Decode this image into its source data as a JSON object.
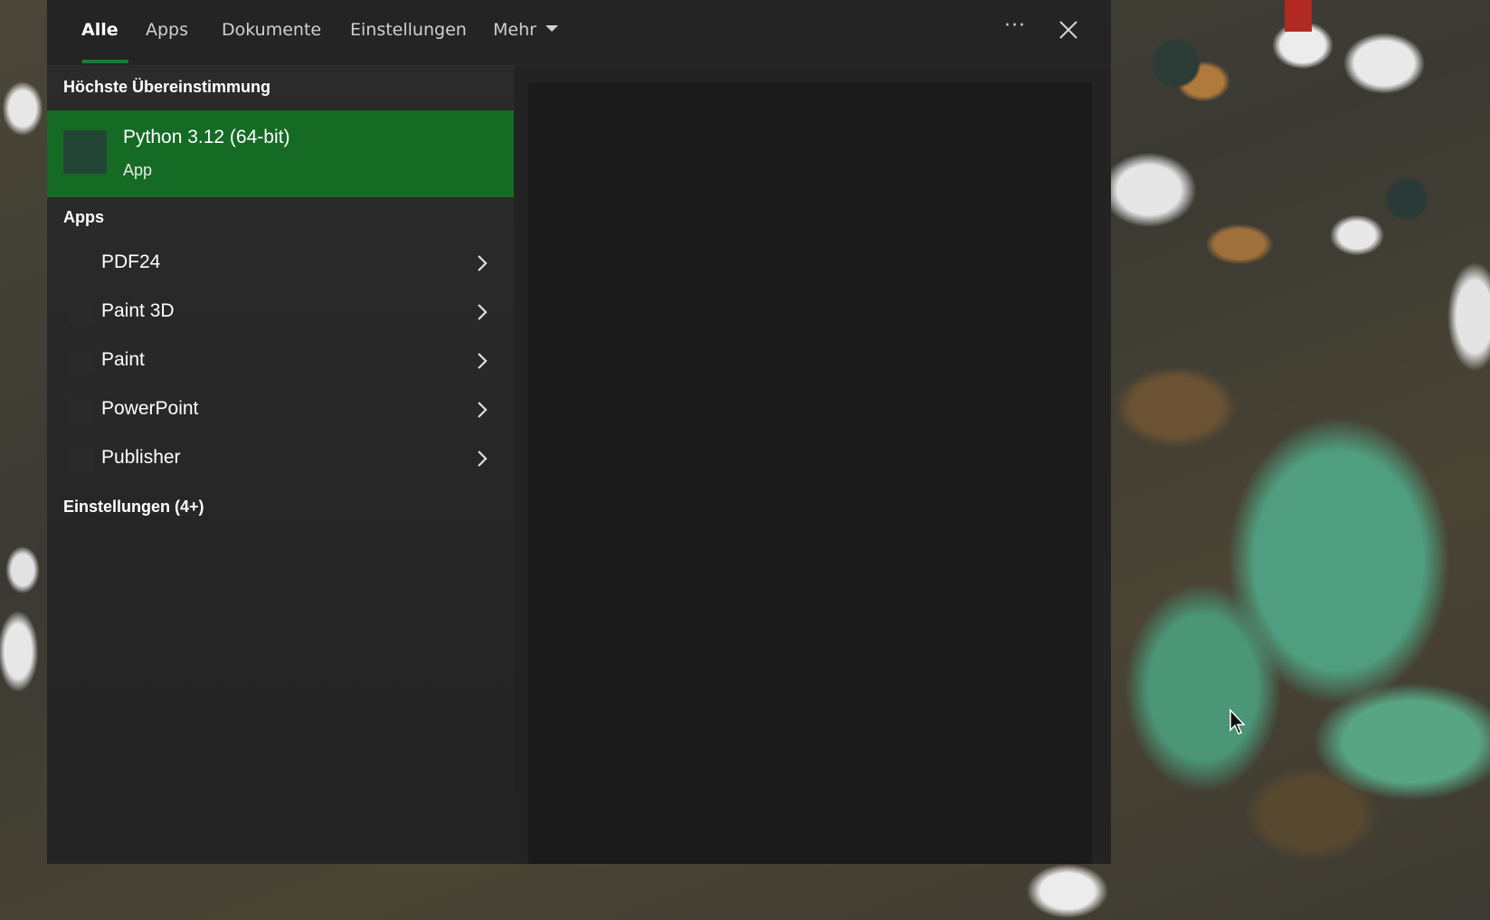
{
  "tabs": [
    {
      "label": "Alle",
      "active": true
    },
    {
      "label": "Apps",
      "active": false
    },
    {
      "label": "Dokumente",
      "active": false
    },
    {
      "label": "Einstellungen",
      "active": false
    },
    {
      "label": "Mehr",
      "active": false
    }
  ],
  "toolbar": {
    "more_options_label": "···",
    "more_options_icon": "ellipsis-icon",
    "close_icon": "close-icon"
  },
  "best_match": {
    "header": "Höchste Übereinstimmung",
    "title": "Python 3.12 (64-bit)",
    "subtitle": "App",
    "highlight_color": "#156b24"
  },
  "apps": {
    "header": "Apps",
    "items": [
      {
        "label": "PDF24"
      },
      {
        "label": "Paint 3D"
      },
      {
        "label": "Paint"
      },
      {
        "label": "PowerPoint"
      },
      {
        "label": "Publisher"
      }
    ]
  },
  "settings": {
    "header": "Einstellungen (4+)"
  },
  "colors": {
    "accent": "#1e7a34",
    "panel": "#252525",
    "preview": "#1b1b1b"
  }
}
